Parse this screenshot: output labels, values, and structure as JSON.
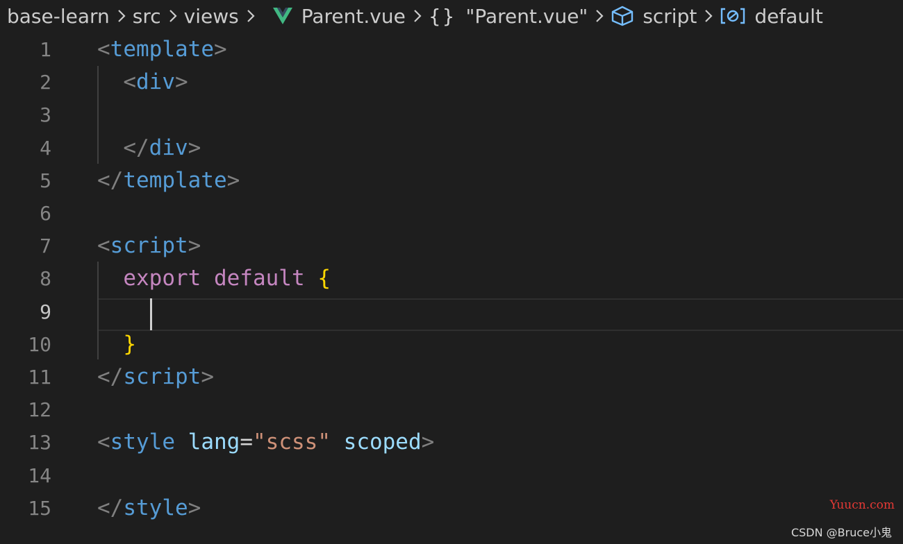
{
  "breadcrumb": {
    "items": [
      {
        "label": "base-learn"
      },
      {
        "label": "src"
      },
      {
        "label": "views"
      },
      {
        "label": "Parent.vue",
        "icon": "vue-icon"
      },
      {
        "label": "\"Parent.vue\"",
        "icon": "braces-icon",
        "icon_text": "{}"
      },
      {
        "label": "script",
        "icon": "cube-icon"
      },
      {
        "label": "default",
        "icon": "variable-icon"
      }
    ]
  },
  "editor": {
    "active_line": 9,
    "lines": [
      {
        "number": "1",
        "tokens": [
          {
            "t": "<",
            "c": "punct"
          },
          {
            "t": "template",
            "c": "tag"
          },
          {
            "t": ">",
            "c": "punct"
          }
        ]
      },
      {
        "number": "2",
        "tokens": [
          {
            "t": "  ",
            "c": "op"
          },
          {
            "t": "<",
            "c": "punct"
          },
          {
            "t": "div",
            "c": "tag"
          },
          {
            "t": ">",
            "c": "punct"
          }
        ]
      },
      {
        "number": "3",
        "tokens": []
      },
      {
        "number": "4",
        "tokens": [
          {
            "t": "  ",
            "c": "op"
          },
          {
            "t": "</",
            "c": "punct"
          },
          {
            "t": "div",
            "c": "tag"
          },
          {
            "t": ">",
            "c": "punct"
          }
        ]
      },
      {
        "number": "5",
        "tokens": [
          {
            "t": "</",
            "c": "punct"
          },
          {
            "t": "template",
            "c": "tag"
          },
          {
            "t": ">",
            "c": "punct"
          }
        ]
      },
      {
        "number": "6",
        "tokens": []
      },
      {
        "number": "7",
        "tokens": [
          {
            "t": "<",
            "c": "punct"
          },
          {
            "t": "script",
            "c": "tag"
          },
          {
            "t": ">",
            "c": "punct"
          }
        ]
      },
      {
        "number": "8",
        "tokens": [
          {
            "t": "  ",
            "c": "op"
          },
          {
            "t": "export",
            "c": "kw"
          },
          {
            "t": " ",
            "c": "op"
          },
          {
            "t": "default",
            "c": "kw"
          },
          {
            "t": " ",
            "c": "op"
          },
          {
            "t": "{",
            "c": "brace"
          }
        ]
      },
      {
        "number": "9",
        "tokens": []
      },
      {
        "number": "10",
        "tokens": [
          {
            "t": "  ",
            "c": "op"
          },
          {
            "t": "}",
            "c": "brace"
          }
        ]
      },
      {
        "number": "11",
        "tokens": [
          {
            "t": "</",
            "c": "punct"
          },
          {
            "t": "script",
            "c": "tag"
          },
          {
            "t": ">",
            "c": "punct"
          }
        ]
      },
      {
        "number": "12",
        "tokens": []
      },
      {
        "number": "13",
        "tokens": [
          {
            "t": "<",
            "c": "punct"
          },
          {
            "t": "style",
            "c": "tag"
          },
          {
            "t": " ",
            "c": "op"
          },
          {
            "t": "lang",
            "c": "attr"
          },
          {
            "t": "=",
            "c": "op"
          },
          {
            "t": "\"scss\"",
            "c": "str"
          },
          {
            "t": " ",
            "c": "op"
          },
          {
            "t": "scoped",
            "c": "attr"
          },
          {
            "t": ">",
            "c": "punct"
          }
        ]
      },
      {
        "number": "14",
        "tokens": []
      },
      {
        "number": "15",
        "tokens": [
          {
            "t": "</",
            "c": "punct"
          },
          {
            "t": "style",
            "c": "tag"
          },
          {
            "t": ">",
            "c": "punct"
          }
        ]
      }
    ]
  },
  "watermarks": {
    "site": "Yuucn.com",
    "author": "CSDN @Bruce小鬼"
  },
  "colors": {
    "background": "#1e1e1e",
    "tag": "#569cd6",
    "punctuation": "#808080",
    "keyword": "#c586c0",
    "brace": "#ffd700",
    "string": "#ce9178",
    "attribute": "#9cdcfe",
    "vue_green": "#41b883",
    "icon_blue": "#75beff"
  }
}
